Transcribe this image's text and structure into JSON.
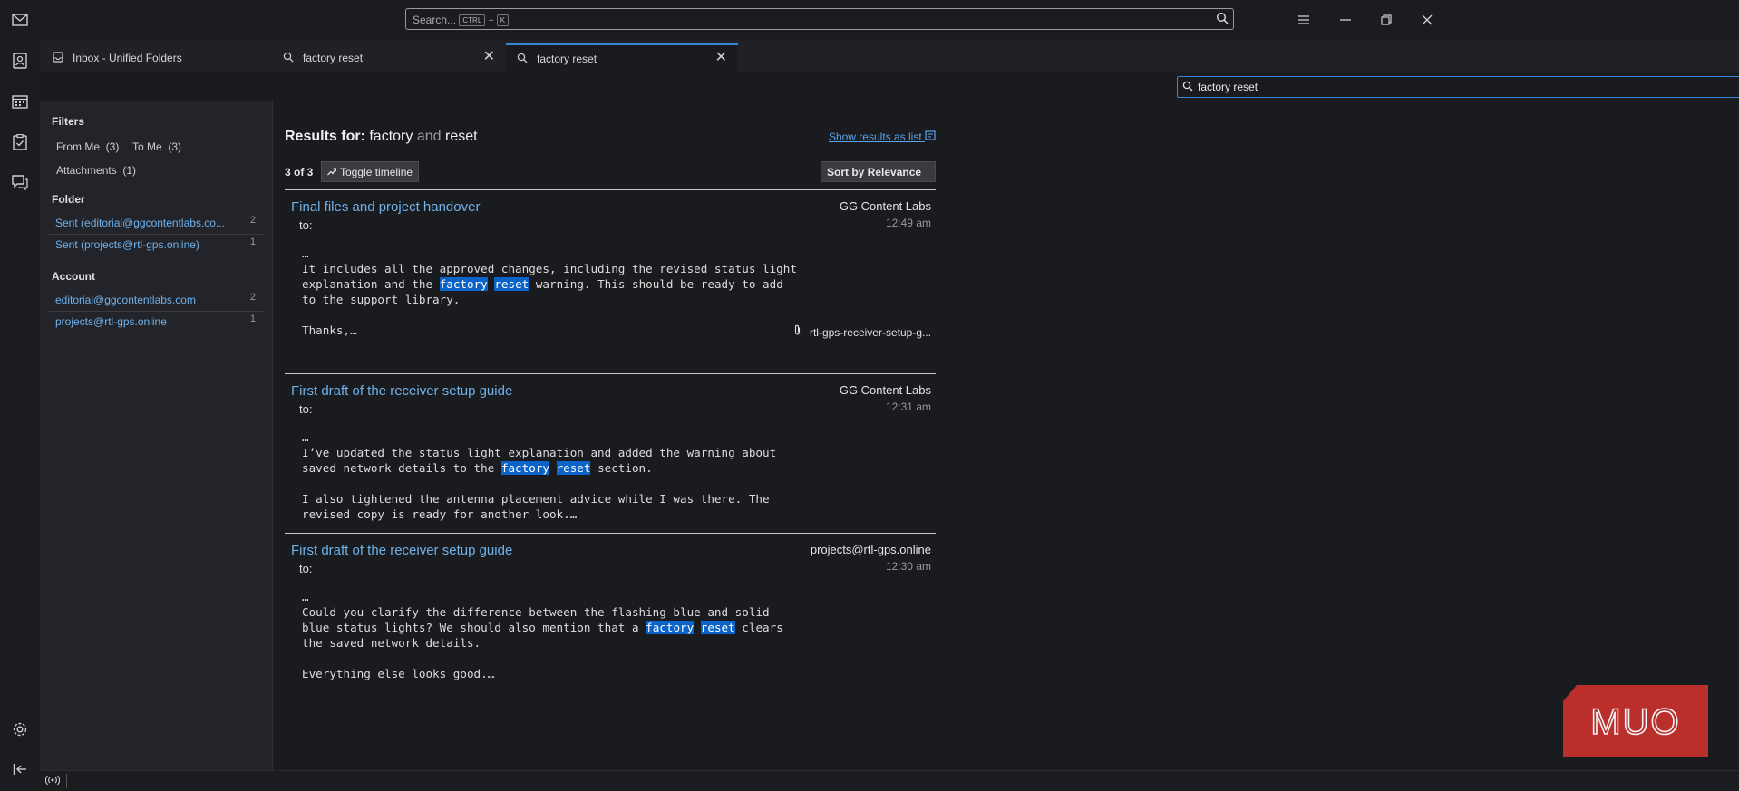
{
  "search": {
    "placeholder": "Search...",
    "shortcut_key1": "CTRL",
    "shortcut_plus": "+",
    "shortcut_key2": "K"
  },
  "tabs": [
    {
      "label": "Inbox - Unified Folders",
      "icon": "inbox-icon"
    },
    {
      "label": "factory reset",
      "icon": "search-icon"
    },
    {
      "label": "factory reset",
      "icon": "search-icon"
    }
  ],
  "query": {
    "value": "factory reset"
  },
  "filters": {
    "heading": "Filters",
    "from_me": "From Me  (3)",
    "to_me": "To Me  (3)",
    "attachments": "Attachments  (1)",
    "folder_heading": "Folder",
    "folders": [
      {
        "label": "Sent (editorial@ggcontentlabs.co...",
        "count": "2"
      },
      {
        "label": "Sent (projects@rtl-gps.online)",
        "count": "1"
      }
    ],
    "account_heading": "Account",
    "accounts": [
      {
        "label": "editorial@ggcontentlabs.com",
        "count": "2"
      },
      {
        "label": "projects@rtl-gps.online",
        "count": "1"
      }
    ]
  },
  "results": {
    "prefix": "Results for:",
    "term1": "factory",
    "joiner": "and",
    "term2": "reset",
    "show_list": "Show results as list",
    "count": "3 of 3",
    "toggle_timeline": "Toggle timeline",
    "sort": "Sort by Relevance"
  },
  "messages": [
    {
      "subject": "Final files and project handover",
      "from": "GG Content Labs",
      "time": "12:49 am",
      "to": "to:",
      "ellipsis": "…",
      "l1": "It includes all the approved changes, including the revised status light",
      "l2a": "explanation and the ",
      "hl1": "factory",
      "hl2": "reset",
      "l2b": " warning. This should be ready to add",
      "l3": "to the support library.",
      "l4": "Thanks,…",
      "attachment": "rtl-gps-receiver-setup-g..."
    },
    {
      "subject": "First draft of the receiver setup guide",
      "from": "GG Content Labs",
      "time": "12:31 am",
      "to": "to:",
      "ellipsis": "…",
      "l1": "I’ve updated the status light explanation and added the warning about",
      "l2a": "saved network details to the ",
      "hl1": "factory",
      "hl2": "reset",
      "l2b": " section.",
      "l3": "I also tightened the antenna placement advice while I was there. The",
      "l4": "revised copy is ready for another look.…"
    },
    {
      "subject": "First draft of the receiver setup guide",
      "from": "projects@rtl-gps.online",
      "time": "12:30 am",
      "to": "to:",
      "ellipsis": "…",
      "l1": "Could you clarify the difference between the flashing blue and solid",
      "l2a": "blue status lights? We should also mention that a ",
      "hl1": "factory",
      "hl2": "reset",
      "l2b": " clears",
      "l3": "the saved network details.",
      "l4": "Everything else looks good.…"
    }
  ],
  "logo": {
    "text": "MUO",
    "color": "#c8302c"
  },
  "colors": {
    "accent": "#3a86d6",
    "link": "#6fb2ec",
    "highlight": "#0a63c8"
  }
}
